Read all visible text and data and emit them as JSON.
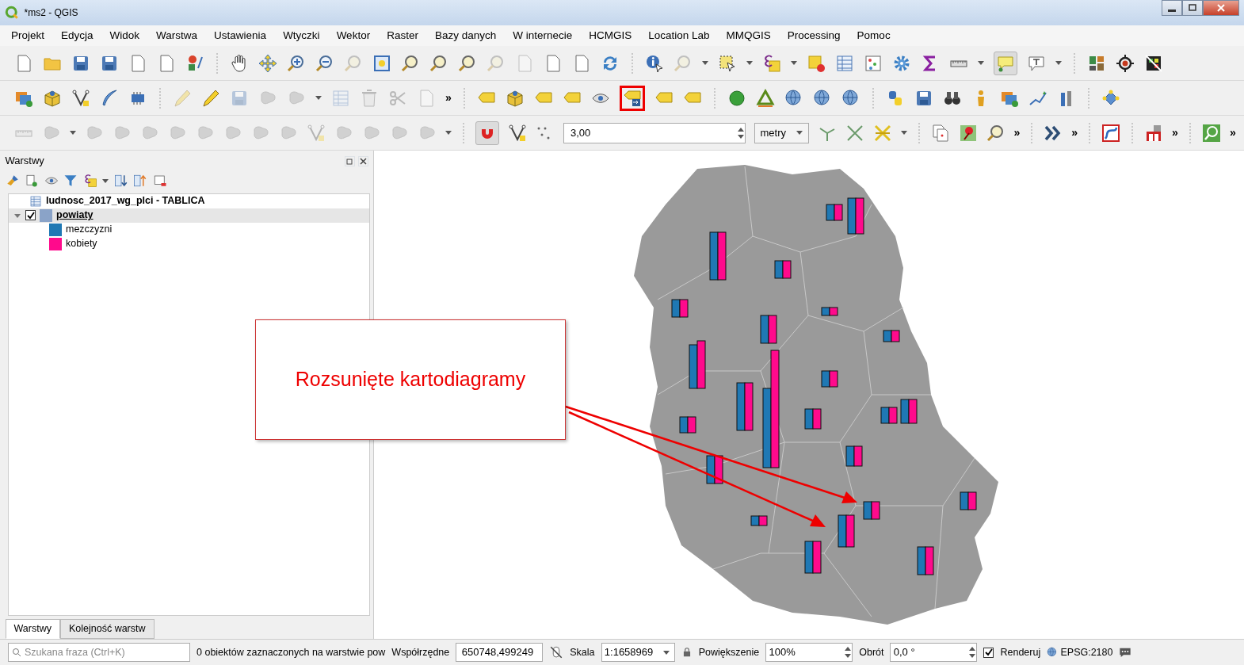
{
  "window": {
    "title": "*ms2 - QGIS"
  },
  "menu": [
    "Projekt",
    "Edycja",
    "Widok",
    "Warstwa",
    "Ustawienia",
    "Wtyczki",
    "Wektor",
    "Raster",
    "Bazy danych",
    "W internecie",
    "HCMGIS",
    "Location Lab",
    "MMQGIS",
    "Processing",
    "Pomoc"
  ],
  "toolbar_1": {
    "tooltip_button": {
      "on": true
    }
  },
  "toolbar_2": {
    "overflow": [
      "»"
    ],
    "label_button": {
      "highlighted": true
    }
  },
  "toolbar_3": {
    "magnet_button": {
      "on": true
    },
    "snap_tolerance": "3,00",
    "snap_units": "metry",
    "overflow": [
      "»",
      "»",
      "»",
      "»"
    ]
  },
  "layers_panel": {
    "title": "Warstwy",
    "layers": [
      {
        "kind": "table",
        "name": "ludnosc_2017_wg_plci - TABLICA"
      },
      {
        "kind": "vector",
        "name": "powiaty",
        "checked": true,
        "expanded": true,
        "selected": true,
        "color": "#8aa3c8",
        "children": [
          {
            "name": "mezczyzni",
            "color": "#1f78b4"
          },
          {
            "name": "kobiety",
            "color": "#ff0a8c"
          }
        ]
      }
    ],
    "tabs": [
      {
        "label": "Warstwy",
        "selected": true
      },
      {
        "label": "Kolejność warstw",
        "selected": false
      }
    ]
  },
  "map": {
    "callout": "Rozsunięte kartodiagramy"
  },
  "status_bar": {
    "search_placeholder": "Szukana fraza (Ctrl+K)",
    "message": "0 obiektów zaznaczonych na warstwie pow",
    "coordinate_label": "Współrzędne",
    "coordinate": "650748,499249",
    "scale_label": "Skala",
    "scale": "1:1658969",
    "magnifier_label": "Powiększenie",
    "magnifier": "100%",
    "rotation_label": "Obrót",
    "rotation": "0,0 °",
    "render": {
      "label": "Renderuj",
      "checked": true
    },
    "crs": "EPSG:2180"
  }
}
